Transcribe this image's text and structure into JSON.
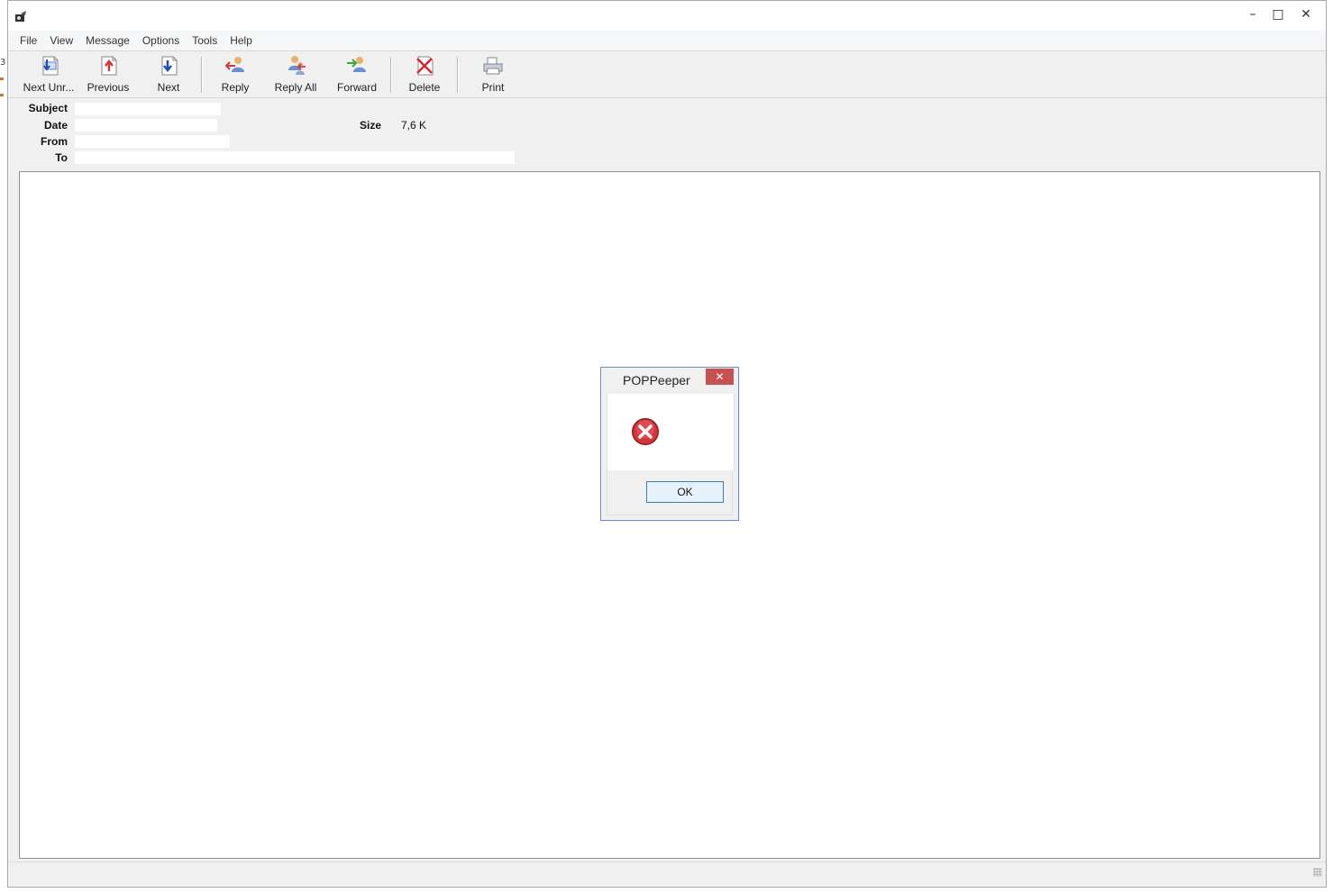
{
  "window": {
    "minimize_glyph": "–",
    "maximize_glyph": "□",
    "close_glyph": "✕"
  },
  "menu": {
    "items": [
      "File",
      "View",
      "Message",
      "Options",
      "Tools",
      "Help"
    ]
  },
  "toolbar": {
    "buttons": [
      {
        "label": "Next Unr...",
        "icon": "next-unread-icon"
      },
      {
        "label": "Previous",
        "icon": "previous-icon"
      },
      {
        "label": "Next",
        "icon": "next-icon"
      },
      {
        "label": "Reply",
        "icon": "reply-icon"
      },
      {
        "label": "Reply All",
        "icon": "reply-all-icon"
      },
      {
        "label": "Forward",
        "icon": "forward-icon"
      },
      {
        "label": "Delete",
        "icon": "delete-icon"
      },
      {
        "label": "Print",
        "icon": "print-icon"
      }
    ]
  },
  "headers": {
    "subject_label": "Subject",
    "date_label": "Date",
    "from_label": "From",
    "to_label": "To",
    "size_label": "Size",
    "size_value": "7,6 K"
  },
  "dialog": {
    "title": "POPPeeper",
    "close_glyph": "✕",
    "icon": "error-icon",
    "ok_label": "OK"
  },
  "colors": {
    "dialog_close_bg": "#c75050",
    "error_red": "#c4262e",
    "ok_border": "#3c7fb1"
  }
}
